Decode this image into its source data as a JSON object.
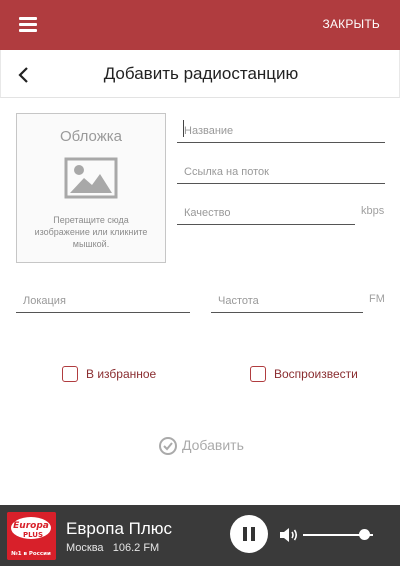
{
  "topbar": {
    "close_label": "ЗАКРЫТЬ",
    "menu_icon": "hamburger-menu-icon"
  },
  "titlebar": {
    "title": "Добавить радиостанцию",
    "back_icon": "chevron-left-icon"
  },
  "cover": {
    "title": "Обложка",
    "hint": "Перетащите сюда изображение или кликните мышкой.",
    "icon": "image-placeholder-icon"
  },
  "form": {
    "name_placeholder": "Название",
    "stream_placeholder": "Ссылка на поток",
    "quality_placeholder": "Качество",
    "quality_unit": "kbps",
    "location_placeholder": "Локация",
    "frequency_placeholder": "Частота",
    "frequency_unit": "FM",
    "favorite_label": "В избранное",
    "play_label": "Воспроизвести",
    "add_label": "Добавить",
    "add_icon": "check-circle-icon"
  },
  "player": {
    "station_name": "Европа Плюс",
    "city": "Москва",
    "frequency": "106.2 FM",
    "logo_main": "Europa",
    "logo_plus": "PLUS",
    "logo_sub": "№1 в России",
    "volume_level": 0.88,
    "colors": {
      "accent": "#b03c3f",
      "player_bg": "#3a3a3a",
      "logo_red": "#d8202a"
    }
  }
}
